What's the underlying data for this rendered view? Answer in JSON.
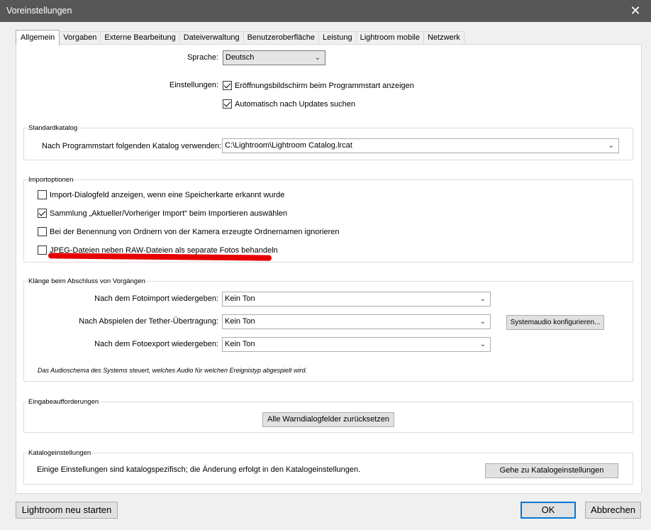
{
  "window": {
    "title": "Voreinstellungen",
    "close_glyph": "✕"
  },
  "tabs": [
    {
      "label": "Allgemein"
    },
    {
      "label": "Vorgaben"
    },
    {
      "label": "Externe Bearbeitung"
    },
    {
      "label": "Dateiverwaltung"
    },
    {
      "label": "Benutzeroberfläche"
    },
    {
      "label": "Leistung"
    },
    {
      "label": "Lightroom mobile"
    },
    {
      "label": "Netzwerk"
    }
  ],
  "language": {
    "label": "Sprache:",
    "value": "Deutsch"
  },
  "settings": {
    "label": "Einstellungen:",
    "splash": "Eröffnungsbildschirm beim Programmstart anzeigen",
    "updates": "Automatisch nach Updates suchen"
  },
  "catalog": {
    "legend": "Standardkatalog",
    "label": "Nach Programmstart folgenden Katalog verwenden:",
    "value": "C:\\Lightroom\\Lightroom Catalog.lrcat"
  },
  "import": {
    "legend": "Importoptionen",
    "options": [
      {
        "label": "Import-Dialogfeld anzeigen, wenn eine Speicherkarte erkannt wurde",
        "checked": false
      },
      {
        "label": "Sammlung „Aktueller/Vorheriger Import“ beim Importieren auswählen",
        "checked": true
      },
      {
        "label": "Bei der Benennung von Ordnern von der Kamera erzeugte Ordnernamen ignorieren",
        "checked": false
      },
      {
        "label": "JPEG-Dateien neben RAW-Dateien als separate Fotos behandeln",
        "checked": false
      }
    ],
    "highlight_color": "#e60000"
  },
  "sounds": {
    "legend": "Klänge beim Abschluss von Vorgängen",
    "rows": [
      {
        "label": "Nach dem Fotoimport wiedergeben:",
        "value": "Kein Ton"
      },
      {
        "label": "Nach Abspielen der Tether-Übertragung:",
        "value": "Kein Ton"
      },
      {
        "label": "Nach dem Fotoexport wiedergeben:",
        "value": "Kein Ton"
      }
    ],
    "configure_button": "Systemaudio konfigurieren...",
    "note": "Das Audioschema des Systems steuert, welches Audio für welchen Ereignistyp abgespielt wird."
  },
  "prompts": {
    "legend": "Eingabeaufforderungen",
    "reset_button": "Alle Warndialogfelder zurücksetzen"
  },
  "catalog_settings": {
    "legend": "Katalogeinstellungen",
    "text": "Einige Einstellungen sind katalogspezifisch; die Änderung erfolgt in den Katalogeinstellungen.",
    "button": "Gehe zu Katalogeinstellungen"
  },
  "footer": {
    "restart": "Lightroom neu starten",
    "ok": "OK",
    "cancel": "Abbrechen"
  },
  "colors": {
    "titlebar": "#575757",
    "focus": "#0078d7"
  }
}
